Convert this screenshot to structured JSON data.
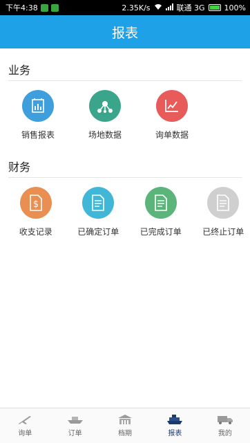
{
  "status_bar": {
    "time": "下午4:38",
    "speed": "2.35K/s",
    "carrier": "联通 3G",
    "battery": "100%"
  },
  "header": {
    "title": "报表"
  },
  "sections": [
    {
      "title": "业务",
      "items": [
        {
          "label": "销售报表",
          "color": "#3f9fdc",
          "icon": "bar-chart-icon"
        },
        {
          "label": "场地数据",
          "color": "#3aa58a",
          "icon": "network-icon"
        },
        {
          "label": "询单数据",
          "color": "#e85b5b",
          "icon": "line-chart-icon"
        }
      ]
    },
    {
      "title": "财务",
      "items": [
        {
          "label": "收支记录",
          "color": "#ea8f52",
          "icon": "dollar-doc-icon"
        },
        {
          "label": "已确定订单",
          "color": "#41b7d8",
          "icon": "document-icon"
        },
        {
          "label": "已完成订单",
          "color": "#5bb57a",
          "icon": "document-icon"
        },
        {
          "label": "已终止订单",
          "color": "#cfcfcf",
          "icon": "document-icon"
        }
      ]
    }
  ],
  "bottom_nav": [
    {
      "label": "询单",
      "icon": "airplane-icon",
      "active": false
    },
    {
      "label": "订单",
      "icon": "ship-icon",
      "active": false
    },
    {
      "label": "档期",
      "icon": "building-icon",
      "active": false
    },
    {
      "label": "报表",
      "icon": "cruise-ship-icon",
      "active": true
    },
    {
      "label": "我的",
      "icon": "truck-icon",
      "active": false
    }
  ]
}
